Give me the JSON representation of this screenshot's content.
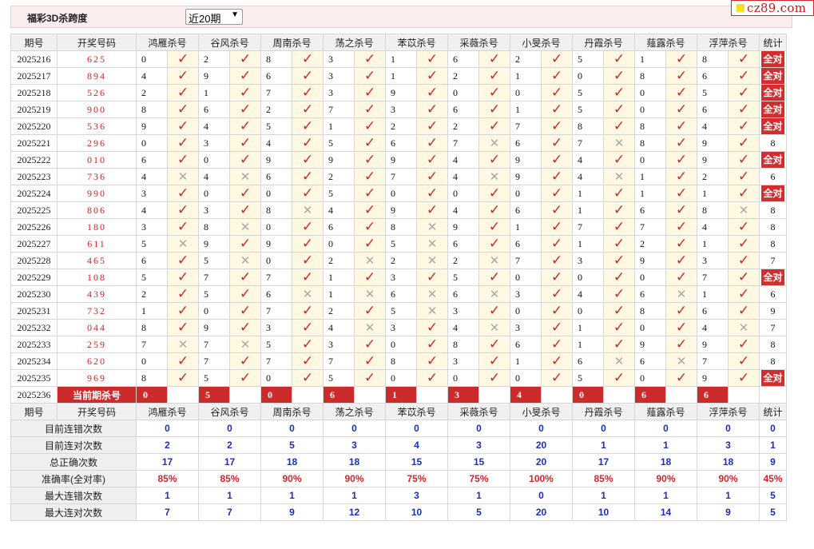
{
  "title": "福彩3D杀跨度",
  "range_select": {
    "value": "近20期",
    "options": [
      "近20期"
    ]
  },
  "logo": {
    "text": "cz89.com",
    "accent": "#f3e21c",
    "color": "#c8171d"
  },
  "headers": [
    "期号",
    "开奖号码",
    "鸿雁杀号",
    "谷风杀号",
    "周南杀号",
    "荡之杀号",
    "苯苡杀号",
    "采薇杀号",
    "小旻杀号",
    "丹霞杀号",
    "薤露杀号",
    "浮萍杀号",
    "统计"
  ],
  "rows": [
    {
      "period": "2025216",
      "draw": "625",
      "nums": [
        "0",
        "2",
        "8",
        "3",
        "1",
        "6",
        "2",
        "5",
        "1",
        "8"
      ],
      "hits": [
        1,
        1,
        1,
        1,
        1,
        1,
        1,
        1,
        1,
        1
      ],
      "stat": "全对"
    },
    {
      "period": "2025217",
      "draw": "894",
      "nums": [
        "4",
        "9",
        "6",
        "3",
        "1",
        "2",
        "1",
        "0",
        "8",
        "6"
      ],
      "hits": [
        1,
        1,
        1,
        1,
        1,
        1,
        1,
        1,
        1,
        1
      ],
      "stat": "全对"
    },
    {
      "period": "2025218",
      "draw": "526",
      "nums": [
        "2",
        "1",
        "7",
        "3",
        "9",
        "0",
        "0",
        "5",
        "0",
        "5"
      ],
      "hits": [
        1,
        1,
        1,
        1,
        1,
        1,
        1,
        1,
        1,
        1
      ],
      "stat": "全对"
    },
    {
      "period": "2025219",
      "draw": "900",
      "nums": [
        "8",
        "6",
        "2",
        "7",
        "3",
        "6",
        "1",
        "5",
        "0",
        "6"
      ],
      "hits": [
        1,
        1,
        1,
        1,
        1,
        1,
        1,
        1,
        1,
        1
      ],
      "stat": "全对"
    },
    {
      "period": "2025220",
      "draw": "536",
      "nums": [
        "9",
        "4",
        "5",
        "1",
        "2",
        "2",
        "7",
        "8",
        "8",
        "4"
      ],
      "hits": [
        1,
        1,
        1,
        1,
        1,
        1,
        1,
        1,
        1,
        1
      ],
      "stat": "全对"
    },
    {
      "period": "2025221",
      "draw": "296",
      "nums": [
        "0",
        "3",
        "4",
        "5",
        "6",
        "7",
        "6",
        "7",
        "8",
        "9"
      ],
      "hits": [
        1,
        1,
        1,
        1,
        1,
        0,
        1,
        0,
        1,
        1
      ],
      "stat": "8"
    },
    {
      "period": "2025222",
      "draw": "010",
      "nums": [
        "6",
        "0",
        "9",
        "9",
        "9",
        "4",
        "9",
        "4",
        "0",
        "9"
      ],
      "hits": [
        1,
        1,
        1,
        1,
        1,
        1,
        1,
        1,
        1,
        1
      ],
      "stat": "全对"
    },
    {
      "period": "2025223",
      "draw": "736",
      "nums": [
        "4",
        "4",
        "6",
        "2",
        "7",
        "4",
        "9",
        "4",
        "1",
        "2"
      ],
      "hits": [
        0,
        0,
        1,
        1,
        1,
        0,
        1,
        0,
        1,
        1
      ],
      "stat": "6"
    },
    {
      "period": "2025224",
      "draw": "990",
      "nums": [
        "3",
        "0",
        "0",
        "5",
        "0",
        "0",
        "0",
        "1",
        "1",
        "1"
      ],
      "hits": [
        1,
        1,
        1,
        1,
        1,
        1,
        1,
        1,
        1,
        1
      ],
      "stat": "全对"
    },
    {
      "period": "2025225",
      "draw": "806",
      "nums": [
        "4",
        "3",
        "8",
        "4",
        "9",
        "4",
        "6",
        "1",
        "6",
        "8"
      ],
      "hits": [
        1,
        1,
        0,
        1,
        1,
        1,
        1,
        1,
        1,
        0
      ],
      "stat": "8"
    },
    {
      "period": "2025226",
      "draw": "180",
      "nums": [
        "3",
        "8",
        "0",
        "6",
        "8",
        "9",
        "1",
        "7",
        "7",
        "4"
      ],
      "hits": [
        1,
        0,
        1,
        1,
        0,
        1,
        1,
        1,
        1,
        1
      ],
      "stat": "8"
    },
    {
      "period": "2025227",
      "draw": "611",
      "nums": [
        "5",
        "9",
        "9",
        "0",
        "5",
        "6",
        "6",
        "1",
        "2",
        "1"
      ],
      "hits": [
        0,
        1,
        1,
        1,
        0,
        1,
        1,
        1,
        1,
        1
      ],
      "stat": "8"
    },
    {
      "period": "2025228",
      "draw": "465",
      "nums": [
        "6",
        "5",
        "0",
        "2",
        "2",
        "2",
        "7",
        "3",
        "9",
        "3"
      ],
      "hits": [
        1,
        0,
        1,
        0,
        0,
        0,
        1,
        1,
        1,
        1
      ],
      "stat": "7"
    },
    {
      "period": "2025229",
      "draw": "108",
      "nums": [
        "5",
        "7",
        "7",
        "1",
        "3",
        "5",
        "0",
        "0",
        "0",
        "7"
      ],
      "hits": [
        1,
        1,
        1,
        1,
        1,
        1,
        1,
        1,
        1,
        1
      ],
      "stat": "全对"
    },
    {
      "period": "2025230",
      "draw": "439",
      "nums": [
        "2",
        "5",
        "6",
        "1",
        "6",
        "6",
        "3",
        "4",
        "6",
        "1"
      ],
      "hits": [
        1,
        1,
        0,
        0,
        0,
        0,
        1,
        1,
        0,
        1
      ],
      "stat": "6"
    },
    {
      "period": "2025231",
      "draw": "732",
      "nums": [
        "1",
        "0",
        "7",
        "2",
        "5",
        "3",
        "0",
        "0",
        "8",
        "6"
      ],
      "hits": [
        1,
        1,
        1,
        1,
        0,
        1,
        1,
        1,
        1,
        1
      ],
      "stat": "9"
    },
    {
      "period": "2025232",
      "draw": "044",
      "nums": [
        "8",
        "9",
        "3",
        "4",
        "3",
        "4",
        "3",
        "1",
        "0",
        "4"
      ],
      "hits": [
        1,
        1,
        1,
        0,
        1,
        0,
        1,
        1,
        1,
        0
      ],
      "stat": "7"
    },
    {
      "period": "2025233",
      "draw": "259",
      "nums": [
        "7",
        "7",
        "5",
        "3",
        "0",
        "8",
        "6",
        "1",
        "9",
        "9"
      ],
      "hits": [
        0,
        0,
        1,
        1,
        1,
        1,
        1,
        1,
        1,
        1
      ],
      "stat": "8"
    },
    {
      "period": "2025234",
      "draw": "620",
      "nums": [
        "0",
        "7",
        "7",
        "7",
        "8",
        "3",
        "1",
        "6",
        "6",
        "7"
      ],
      "hits": [
        1,
        1,
        1,
        1,
        1,
        1,
        1,
        0,
        0,
        1
      ],
      "stat": "8"
    },
    {
      "period": "2025235",
      "draw": "969",
      "nums": [
        "8",
        "5",
        "0",
        "5",
        "0",
        "0",
        "0",
        "5",
        "0",
        "9"
      ],
      "hits": [
        1,
        1,
        1,
        1,
        1,
        1,
        1,
        1,
        1,
        1
      ],
      "stat": "全对"
    }
  ],
  "current": {
    "period": "2025236",
    "label": "当前期杀号",
    "nums": [
      "0",
      "5",
      "0",
      "6",
      "1",
      "3",
      "4",
      "0",
      "6",
      "6"
    ]
  },
  "stats": [
    {
      "label": "目前连错次数",
      "values": [
        "0",
        "0",
        "0",
        "0",
        "0",
        "0",
        "0",
        "0",
        "0",
        "0",
        "0"
      ],
      "rate": false
    },
    {
      "label": "目前连对次数",
      "values": [
        "2",
        "2",
        "5",
        "3",
        "4",
        "3",
        "20",
        "1",
        "1",
        "3",
        "1"
      ],
      "rate": false
    },
    {
      "label": "总正确次数",
      "values": [
        "17",
        "17",
        "18",
        "18",
        "15",
        "15",
        "20",
        "17",
        "18",
        "18",
        "9"
      ],
      "rate": false
    },
    {
      "label": "准确率(全对率)",
      "values": [
        "85%",
        "85%",
        "90%",
        "90%",
        "75%",
        "75%",
        "100%",
        "85%",
        "90%",
        "90%",
        "45%"
      ],
      "rate": true
    },
    {
      "label": "最大连错次数",
      "values": [
        "1",
        "1",
        "1",
        "1",
        "3",
        "1",
        "0",
        "1",
        "1",
        "1",
        "5"
      ],
      "rate": false
    },
    {
      "label": "最大连对次数",
      "values": [
        "7",
        "7",
        "9",
        "12",
        "10",
        "5",
        "20",
        "10",
        "14",
        "9",
        "5"
      ],
      "rate": false
    }
  ],
  "marks": {
    "hit": "✓",
    "miss": "✕"
  },
  "colors": {
    "accent_red": "#cc2b2b",
    "stat_blue": "#1b2fb8",
    "marker_bg": "#fff9e4"
  }
}
